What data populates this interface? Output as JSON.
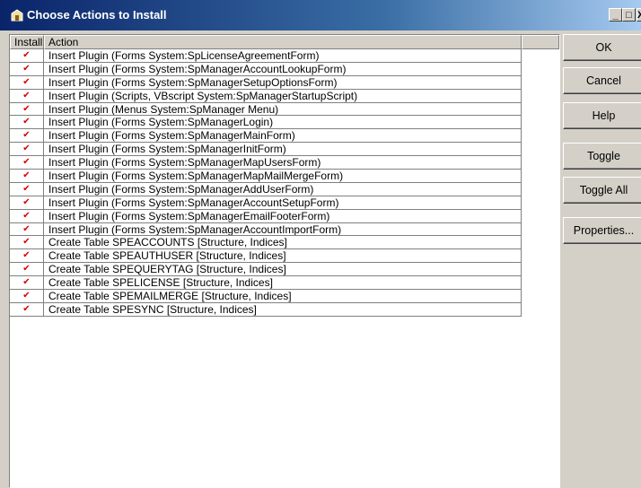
{
  "window": {
    "title": "Choose Actions to Install",
    "minimize_glyph": "_",
    "maximize_glyph": "□",
    "close_glyph": "X"
  },
  "list": {
    "columns": {
      "install": "Install",
      "action": "Action"
    },
    "check_glyph": "✔",
    "rows": [
      {
        "installed": true,
        "action": "Insert Plugin (Forms System:SpLicenseAgreementForm)"
      },
      {
        "installed": true,
        "action": "Insert Plugin (Forms System:SpManagerAccountLookupForm)"
      },
      {
        "installed": true,
        "action": "Insert Plugin (Forms System:SpManagerSetupOptionsForm)"
      },
      {
        "installed": true,
        "action": "Insert Plugin (Scripts, VBscript System:SpManagerStartupScript)"
      },
      {
        "installed": true,
        "action": "Insert Plugin (Menus System:SpManager Menu)"
      },
      {
        "installed": true,
        "action": "Insert Plugin (Forms System:SpManagerLogin)"
      },
      {
        "installed": true,
        "action": "Insert Plugin (Forms System:SpManagerMainForm)"
      },
      {
        "installed": true,
        "action": "Insert Plugin (Forms System:SpManagerInitForm)"
      },
      {
        "installed": true,
        "action": "Insert Plugin (Forms System:SpManagerMapUsersForm)"
      },
      {
        "installed": true,
        "action": "Insert Plugin (Forms System:SpManagerMapMailMergeForm)"
      },
      {
        "installed": true,
        "action": "Insert Plugin (Forms System:SpManagerAddUserForm)"
      },
      {
        "installed": true,
        "action": "Insert Plugin (Forms System:SpManagerAccountSetupForm)"
      },
      {
        "installed": true,
        "action": "Insert Plugin (Forms System:SpManagerEmailFooterForm)"
      },
      {
        "installed": true,
        "action": "Insert Plugin (Forms System:SpManagerAccountImportForm)"
      },
      {
        "installed": true,
        "action": "Create Table SPEACCOUNTS [Structure, Indices]"
      },
      {
        "installed": true,
        "action": "Create Table SPEAUTHUSER [Structure, Indices]"
      },
      {
        "installed": true,
        "action": "Create Table SPEQUERYTAG [Structure, Indices]"
      },
      {
        "installed": true,
        "action": "Create Table SPELICENSE [Structure, Indices]"
      },
      {
        "installed": true,
        "action": "Create Table SPEMAILMERGE [Structure, Indices]"
      },
      {
        "installed": true,
        "action": "Create Table SPESYNC [Structure, Indices]"
      }
    ]
  },
  "buttons": {
    "ok": "OK",
    "cancel": "Cancel",
    "help": "Help",
    "toggle": "Toggle",
    "toggle_all": "Toggle All",
    "properties": "Properties..."
  },
  "colors": {
    "titlebar": "#0a246a",
    "check": "#d40000",
    "face": "#d4d0c8"
  }
}
